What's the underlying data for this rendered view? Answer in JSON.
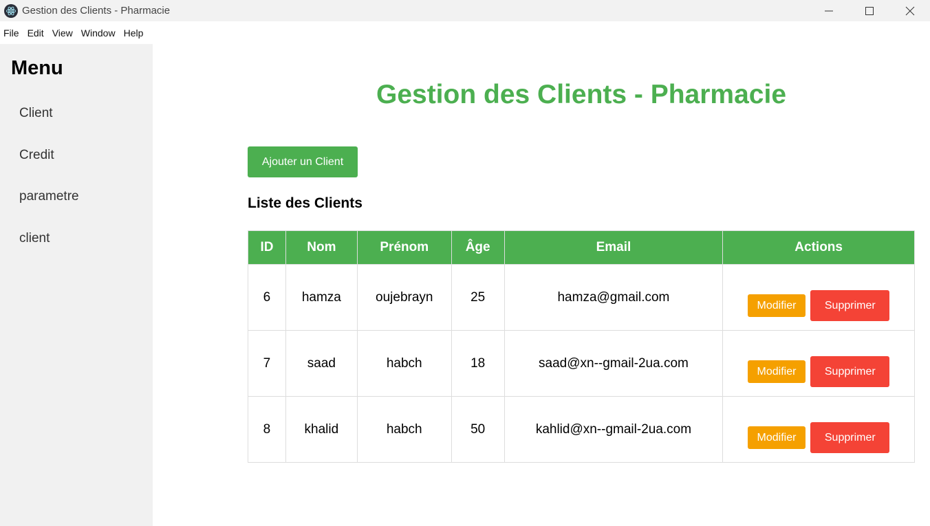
{
  "window": {
    "title": "Gestion des Clients - Pharmacie",
    "icon": "electron-app-icon"
  },
  "menubar": [
    "File",
    "Edit",
    "View",
    "Window",
    "Help"
  ],
  "sidebar": {
    "title": "Menu",
    "items": [
      "Client",
      "Credit",
      "parametre",
      "client"
    ]
  },
  "main": {
    "title": "Gestion des Clients - Pharmacie",
    "add_button": "Ajouter un Client",
    "list_title": "Liste des Clients"
  },
  "table": {
    "headers": [
      "ID",
      "Nom",
      "Prénom",
      "Âge",
      "Email",
      "Actions"
    ],
    "rows": [
      {
        "id": "6",
        "nom": "hamza",
        "prenom": "oujebrayn",
        "age": "25",
        "email": "hamza@gmail.com"
      },
      {
        "id": "7",
        "nom": "saad",
        "prenom": "habch",
        "age": "18",
        "email": "saad@xn--gmail-2ua.com"
      },
      {
        "id": "8",
        "nom": "khalid",
        "prenom": "habch",
        "age": "50",
        "email": "kahlid@xn--gmail-2ua.com"
      }
    ],
    "modify_label": "Modifier",
    "delete_label": "Supprimer"
  },
  "colors": {
    "accent": "#4caf50",
    "modify": "#f5a000",
    "delete": "#f44336",
    "sidebar_bg": "#f1f1f1"
  }
}
